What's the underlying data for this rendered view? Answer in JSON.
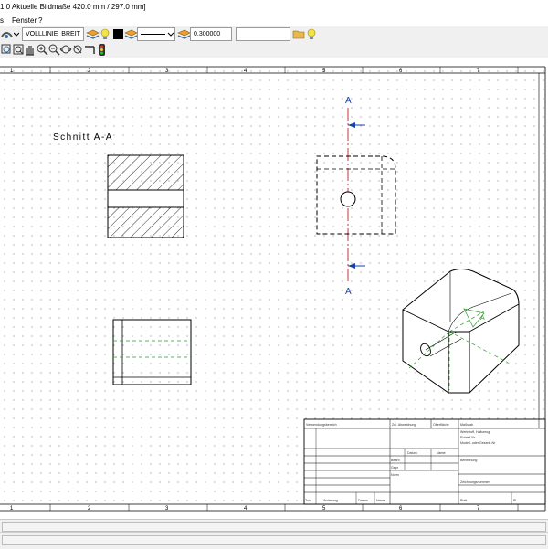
{
  "window": {
    "title": "1.0   Aktuelle Bildmaße 420.0 mm / 297.0 mm]"
  },
  "menu": {
    "items": [
      {
        "label": "s"
      },
      {
        "label": "Fenster"
      },
      {
        "label": "?"
      }
    ]
  },
  "toolbar": {
    "line_type_value": "VOLLLINIE_BREIT",
    "line_width_value": "0.300000",
    "layer_value": ""
  },
  "drawing": {
    "section_label": "Schnitt A-A",
    "section_marker_top": "A",
    "section_marker_bottom": "A",
    "detail_label": "A",
    "column_numbers_top": [
      "1",
      "2",
      "3",
      "4",
      "5",
      "6",
      "7"
    ],
    "column_numbers_bottom": [
      "1",
      "2",
      "3",
      "4",
      "5",
      "6",
      "7"
    ]
  },
  "title_block": {
    "verwendung": "Verwendungsbereich",
    "zul_abweichung": "Zul. Abweichung",
    "oberflaeche": "Oberfläche",
    "massstab": "Maßstab",
    "werkstoff": "Werkstoff, Halbzeug",
    "rohteilnr": "Rohteil-Nr",
    "modell": "Modell- oder Gesenk-Nr",
    "datum": "Datum",
    "name": "Name",
    "benennung": "Benennung",
    "bearb": "Bearb",
    "gepr": "Gepr",
    "norm": "Norm",
    "zeichnungsnummer": "Zeichnungsnummer",
    "zust": "Zust",
    "aenderung": "Änderung",
    "datum2": "Datum",
    "name2": "Name",
    "blatt": "Blatt",
    "bl": "Bl"
  }
}
